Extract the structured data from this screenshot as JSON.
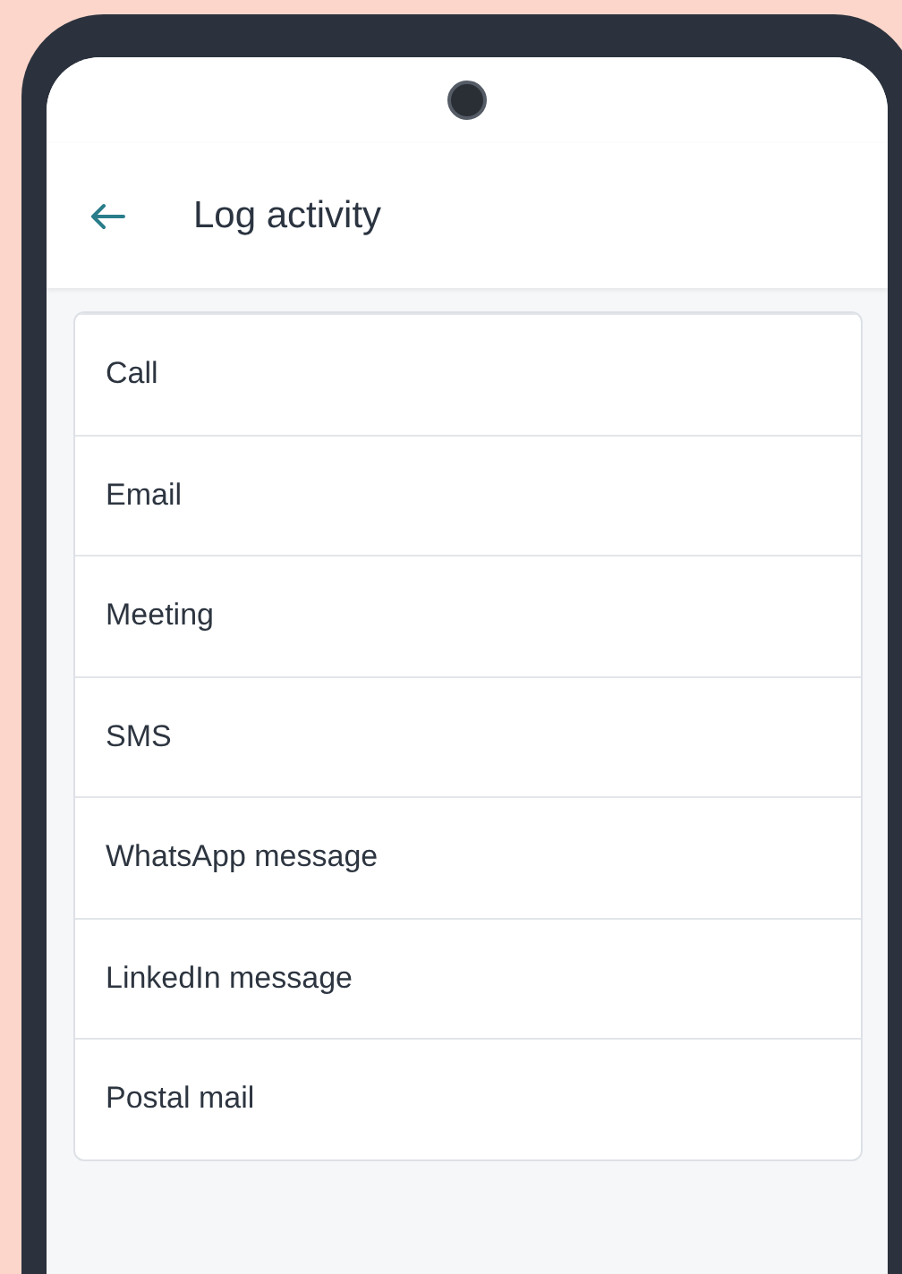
{
  "header": {
    "title": "Log activity"
  },
  "activity_types": [
    {
      "label": "Call"
    },
    {
      "label": "Email"
    },
    {
      "label": "Meeting"
    },
    {
      "label": "SMS"
    },
    {
      "label": "WhatsApp message"
    },
    {
      "label": "LinkedIn message"
    },
    {
      "label": "Postal mail"
    }
  ]
}
